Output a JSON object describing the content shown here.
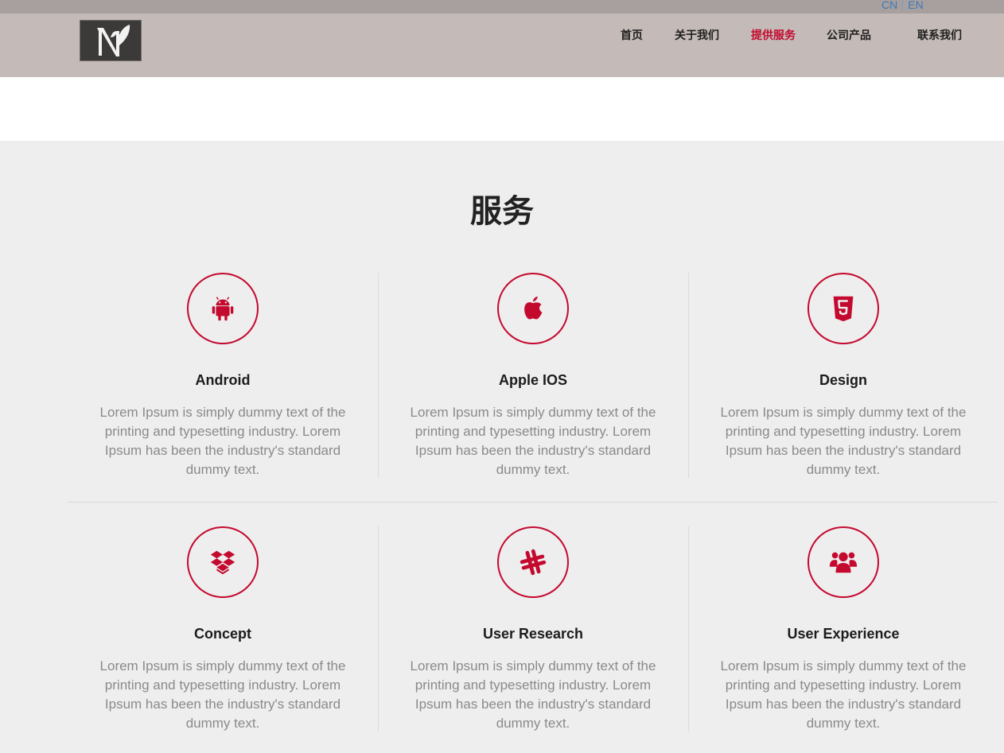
{
  "language_switch": {
    "cn": "CN",
    "en": "EN"
  },
  "nav": {
    "items": [
      {
        "label": "首页"
      },
      {
        "label": "关于我们"
      },
      {
        "label": "提供服务"
      },
      {
        "label": "公司产品"
      },
      {
        "label": "联系我们"
      }
    ],
    "active_index": 2
  },
  "colors": {
    "accent": "#c4092f",
    "header_bg": "#c4bab7",
    "topbar_bg": "#a7a09f",
    "section_bg": "#eeeeee"
  },
  "services": {
    "title": "服务",
    "items": [
      {
        "icon": "android-icon",
        "title": "Android",
        "description": "Lorem Ipsum is simply dummy text of the printing and typesetting industry. Lorem Ipsum has been the industry's standard dummy text."
      },
      {
        "icon": "apple-icon",
        "title": "Apple IOS",
        "description": "Lorem Ipsum is simply dummy text of the printing and typesetting industry. Lorem Ipsum has been the industry's standard dummy text."
      },
      {
        "icon": "html5-icon",
        "title": "Design",
        "description": "Lorem Ipsum is simply dummy text of the printing and typesetting industry. Lorem Ipsum has been the industry's standard dummy text."
      },
      {
        "icon": "dropbox-icon",
        "title": "Concept",
        "description": "Lorem Ipsum is simply dummy text of the printing and typesetting industry. Lorem Ipsum has been the industry's standard dummy text."
      },
      {
        "icon": "slack-icon",
        "title": "User Research",
        "description": "Lorem Ipsum is simply dummy text of the printing and typesetting industry. Lorem Ipsum has been the industry's standard dummy text."
      },
      {
        "icon": "users-icon",
        "title": "User Experience",
        "description": "Lorem Ipsum is simply dummy text of the printing and typesetting industry. Lorem Ipsum has been the industry's standard dummy text."
      }
    ]
  }
}
